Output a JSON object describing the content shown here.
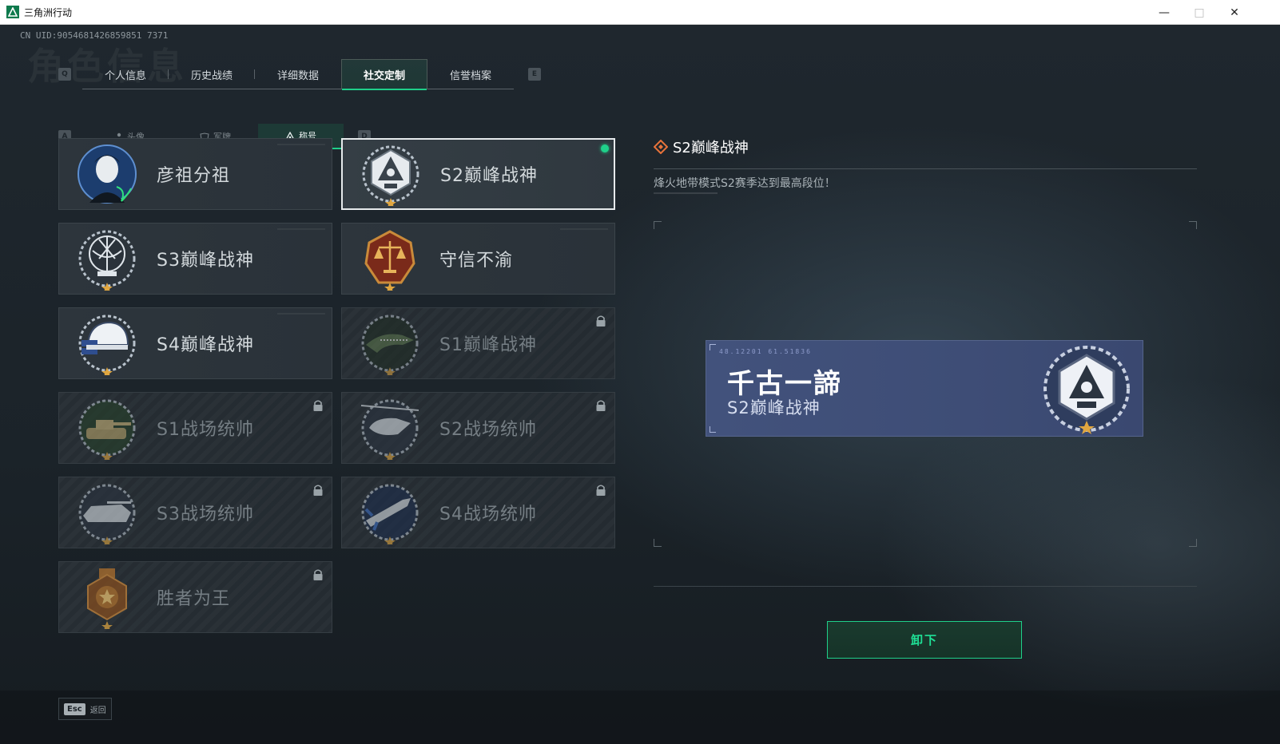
{
  "window": {
    "title": "三角洲行动",
    "minimize_icon": "minimize-icon",
    "maximize_icon": "maximize-icon",
    "close_icon": "close-icon"
  },
  "account": {
    "uid_text": "CN UID:9054681426859851 7371"
  },
  "background_title": "角色信息",
  "main_tabs": {
    "prev_key": "Q",
    "next_key": "E",
    "items": [
      {
        "label": "个人信息",
        "active": false
      },
      {
        "label": "历史战绩",
        "active": false
      },
      {
        "label": "详细数据",
        "active": false
      },
      {
        "label": "社交定制",
        "active": true
      },
      {
        "label": "信誉档案",
        "active": false
      }
    ]
  },
  "sub_tabs": {
    "prev_key": "A",
    "next_key": "D",
    "items": [
      {
        "label": "头像",
        "icon": "person-icon",
        "active": false
      },
      {
        "label": "军牌",
        "icon": "dogtag-icon",
        "active": false
      },
      {
        "label": "称号",
        "icon": "title-triangle-icon",
        "active": true
      }
    ]
  },
  "titles": [
    {
      "name": "彦祖分祖",
      "emblem": "portrait-emblem",
      "locked": false,
      "selected": false
    },
    {
      "name": "S2巅峰战神",
      "emblem": "peak-god-emblem",
      "locked": false,
      "selected": true
    },
    {
      "name": "S3巅峰战神",
      "emblem": "scales-globe-emblem",
      "locked": false,
      "selected": false
    },
    {
      "name": "守信不渝",
      "emblem": "justice-scales-emblem",
      "locked": false,
      "selected": false
    },
    {
      "name": "S4巅峰战神",
      "emblem": "helmet-emblem",
      "locked": false,
      "selected": false
    },
    {
      "name": "S1巅峰战神",
      "emblem": "crocodile-emblem",
      "locked": true,
      "selected": false
    },
    {
      "name": "S1战场统帅",
      "emblem": "tank-emblem",
      "locked": true,
      "selected": false
    },
    {
      "name": "S2战场统帅",
      "emblem": "helicopter-emblem",
      "locked": true,
      "selected": false
    },
    {
      "name": "S3战场统帅",
      "emblem": "armored-vehicle-emblem",
      "locked": true,
      "selected": false
    },
    {
      "name": "S4战场统帅",
      "emblem": "missile-emblem",
      "locked": true,
      "selected": false
    },
    {
      "name": "胜者为王",
      "emblem": "medal-emblem",
      "locked": true,
      "selected": false
    }
  ],
  "detail": {
    "icon": "diamond-marker-icon",
    "name": "S2巅峰战神",
    "description": "烽火地带模式S2赛季达到最高段位！"
  },
  "nameplate": {
    "code_text": "48.12201  61.51836",
    "player_name": "千古一諦",
    "title": "S2巅峰战神",
    "emblem": "peak-god-emblem"
  },
  "action_button": {
    "label": "卸下"
  },
  "footer": {
    "esc_key": "Esc",
    "esc_label": "返回"
  },
  "colors": {
    "accent": "#1fd08a",
    "background": "#1a2229",
    "card": "#2d353c",
    "nameplate": "#42527c",
    "bronze": "#b7742c"
  }
}
